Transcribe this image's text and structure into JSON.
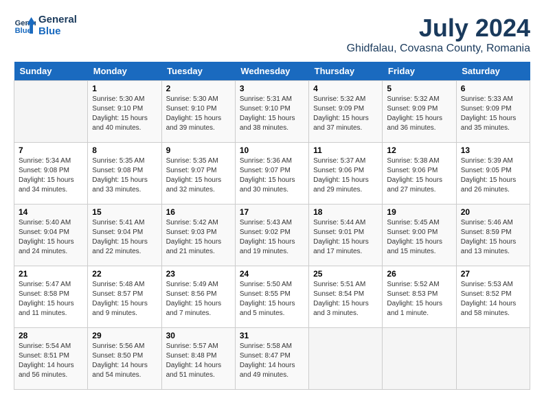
{
  "header": {
    "logo_line1": "General",
    "logo_line2": "Blue",
    "main_title": "July 2024",
    "subtitle": "Ghidfalau, Covasna County, Romania"
  },
  "calendar": {
    "days_of_week": [
      "Sunday",
      "Monday",
      "Tuesday",
      "Wednesday",
      "Thursday",
      "Friday",
      "Saturday"
    ],
    "weeks": [
      [
        {
          "day": "",
          "info": ""
        },
        {
          "day": "1",
          "info": "Sunrise: 5:30 AM\nSunset: 9:10 PM\nDaylight: 15 hours\nand 40 minutes."
        },
        {
          "day": "2",
          "info": "Sunrise: 5:30 AM\nSunset: 9:10 PM\nDaylight: 15 hours\nand 39 minutes."
        },
        {
          "day": "3",
          "info": "Sunrise: 5:31 AM\nSunset: 9:10 PM\nDaylight: 15 hours\nand 38 minutes."
        },
        {
          "day": "4",
          "info": "Sunrise: 5:32 AM\nSunset: 9:09 PM\nDaylight: 15 hours\nand 37 minutes."
        },
        {
          "day": "5",
          "info": "Sunrise: 5:32 AM\nSunset: 9:09 PM\nDaylight: 15 hours\nand 36 minutes."
        },
        {
          "day": "6",
          "info": "Sunrise: 5:33 AM\nSunset: 9:09 PM\nDaylight: 15 hours\nand 35 minutes."
        }
      ],
      [
        {
          "day": "7",
          "info": "Sunrise: 5:34 AM\nSunset: 9:08 PM\nDaylight: 15 hours\nand 34 minutes."
        },
        {
          "day": "8",
          "info": "Sunrise: 5:35 AM\nSunset: 9:08 PM\nDaylight: 15 hours\nand 33 minutes."
        },
        {
          "day": "9",
          "info": "Sunrise: 5:35 AM\nSunset: 9:07 PM\nDaylight: 15 hours\nand 32 minutes."
        },
        {
          "day": "10",
          "info": "Sunrise: 5:36 AM\nSunset: 9:07 PM\nDaylight: 15 hours\nand 30 minutes."
        },
        {
          "day": "11",
          "info": "Sunrise: 5:37 AM\nSunset: 9:06 PM\nDaylight: 15 hours\nand 29 minutes."
        },
        {
          "day": "12",
          "info": "Sunrise: 5:38 AM\nSunset: 9:06 PM\nDaylight: 15 hours\nand 27 minutes."
        },
        {
          "day": "13",
          "info": "Sunrise: 5:39 AM\nSunset: 9:05 PM\nDaylight: 15 hours\nand 26 minutes."
        }
      ],
      [
        {
          "day": "14",
          "info": "Sunrise: 5:40 AM\nSunset: 9:04 PM\nDaylight: 15 hours\nand 24 minutes."
        },
        {
          "day": "15",
          "info": "Sunrise: 5:41 AM\nSunset: 9:04 PM\nDaylight: 15 hours\nand 22 minutes."
        },
        {
          "day": "16",
          "info": "Sunrise: 5:42 AM\nSunset: 9:03 PM\nDaylight: 15 hours\nand 21 minutes."
        },
        {
          "day": "17",
          "info": "Sunrise: 5:43 AM\nSunset: 9:02 PM\nDaylight: 15 hours\nand 19 minutes."
        },
        {
          "day": "18",
          "info": "Sunrise: 5:44 AM\nSunset: 9:01 PM\nDaylight: 15 hours\nand 17 minutes."
        },
        {
          "day": "19",
          "info": "Sunrise: 5:45 AM\nSunset: 9:00 PM\nDaylight: 15 hours\nand 15 minutes."
        },
        {
          "day": "20",
          "info": "Sunrise: 5:46 AM\nSunset: 8:59 PM\nDaylight: 15 hours\nand 13 minutes."
        }
      ],
      [
        {
          "day": "21",
          "info": "Sunrise: 5:47 AM\nSunset: 8:58 PM\nDaylight: 15 hours\nand 11 minutes."
        },
        {
          "day": "22",
          "info": "Sunrise: 5:48 AM\nSunset: 8:57 PM\nDaylight: 15 hours\nand 9 minutes."
        },
        {
          "day": "23",
          "info": "Sunrise: 5:49 AM\nSunset: 8:56 PM\nDaylight: 15 hours\nand 7 minutes."
        },
        {
          "day": "24",
          "info": "Sunrise: 5:50 AM\nSunset: 8:55 PM\nDaylight: 15 hours\nand 5 minutes."
        },
        {
          "day": "25",
          "info": "Sunrise: 5:51 AM\nSunset: 8:54 PM\nDaylight: 15 hours\nand 3 minutes."
        },
        {
          "day": "26",
          "info": "Sunrise: 5:52 AM\nSunset: 8:53 PM\nDaylight: 15 hours\nand 1 minute."
        },
        {
          "day": "27",
          "info": "Sunrise: 5:53 AM\nSunset: 8:52 PM\nDaylight: 14 hours\nand 58 minutes."
        }
      ],
      [
        {
          "day": "28",
          "info": "Sunrise: 5:54 AM\nSunset: 8:51 PM\nDaylight: 14 hours\nand 56 minutes."
        },
        {
          "day": "29",
          "info": "Sunrise: 5:56 AM\nSunset: 8:50 PM\nDaylight: 14 hours\nand 54 minutes."
        },
        {
          "day": "30",
          "info": "Sunrise: 5:57 AM\nSunset: 8:48 PM\nDaylight: 14 hours\nand 51 minutes."
        },
        {
          "day": "31",
          "info": "Sunrise: 5:58 AM\nSunset: 8:47 PM\nDaylight: 14 hours\nand 49 minutes."
        },
        {
          "day": "",
          "info": ""
        },
        {
          "day": "",
          "info": ""
        },
        {
          "day": "",
          "info": ""
        }
      ]
    ]
  }
}
